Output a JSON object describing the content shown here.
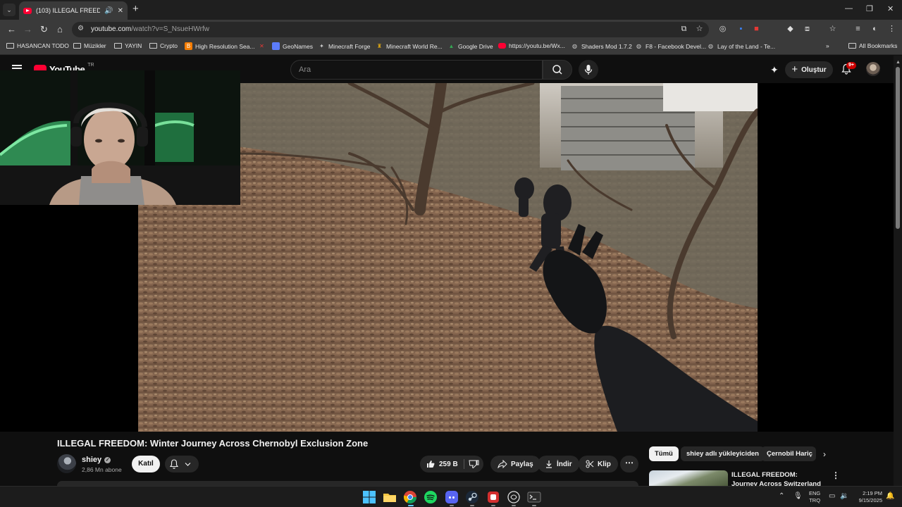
{
  "browser": {
    "tab": {
      "title": "(103) ILLEGAL FREEDOM: W"
    },
    "address": {
      "domain": "youtube.com",
      "path": "/watch?v=S_NsueHWrfw"
    },
    "bookmarks": [
      "HASANCAN TODO",
      "Müzikler",
      "YAYIN",
      "Crypto",
      "High Resolution Sea...",
      "GeoNames",
      "Minecraft Forge",
      "Minecraft World Re...",
      "Google Drive",
      "https://youtu.be/Wx...",
      "Shaders Mod 1.7.2",
      "F8 - Facebook Devel...",
      "Lay of the Land - Te..."
    ],
    "all_bookmarks": "All Bookmarks"
  },
  "youtube": {
    "logo": "YouTube",
    "region": "TR",
    "search_placeholder": "Ara",
    "create_label": "Oluştur",
    "notification_count": "9+"
  },
  "video": {
    "title": "ILLEGAL FREEDOM: Winter Journey Across Chernobyl Exclusion Zone",
    "channel": "shiey",
    "subscribers": "2,86 Mn abone",
    "join_label": "Katıl",
    "likes": "259 B",
    "share_label": "Paylaş",
    "download_label": "İndir",
    "clip_label": "Klip"
  },
  "chips": [
    "Tümü",
    "shiey adlı yükleyiciden",
    "Çernobil Hariç"
  ],
  "recommendation": {
    "title": "ILLEGAL FREEDOM: Journey Across Switzerland"
  },
  "taskbar": {
    "lang_line1": "ENG",
    "lang_line2": "TRQ",
    "time": "2:19 PM",
    "date": "9/15/2025"
  },
  "colors": {
    "accent": "#ff0033",
    "page_bg": "#0f0f0f",
    "chip_selected_bg": "#f1f1f1"
  }
}
